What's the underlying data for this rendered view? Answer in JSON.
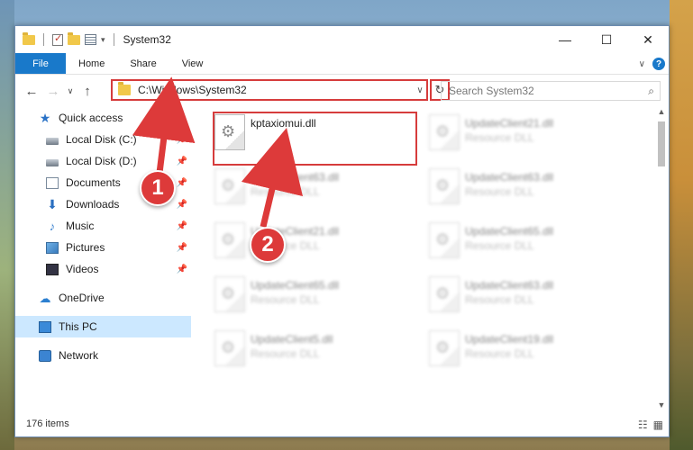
{
  "window": {
    "title": "System32",
    "minimize": "—",
    "maximize": "☐",
    "close": "✕"
  },
  "ribbon": {
    "file": "File",
    "tabs": [
      "Home",
      "Share",
      "View"
    ],
    "expand": "∨",
    "help": "?"
  },
  "nav": {
    "back": "←",
    "forward": "→",
    "recent": "∨",
    "up": "↑",
    "address": "C:\\Windows\\System32",
    "address_dropdown": "∨",
    "refresh": "↻",
    "search_placeholder": "Search System32",
    "search_icon": "⌕"
  },
  "sidebar": {
    "quick_access": "Quick access",
    "items": [
      {
        "label": "Local Disk (C:)",
        "icon": "disk-icon"
      },
      {
        "label": "Local Disk (D:)",
        "icon": "disk-icon"
      },
      {
        "label": "Documents",
        "icon": "documents-icon"
      },
      {
        "label": "Downloads",
        "icon": "download-icon"
      },
      {
        "label": "Music",
        "icon": "music-icon"
      },
      {
        "label": "Pictures",
        "icon": "pictures-icon"
      },
      {
        "label": "Videos",
        "icon": "videos-icon"
      }
    ],
    "onedrive": "OneDrive",
    "thispc": "This PC",
    "network": "Network"
  },
  "files": [
    {
      "name": "kptaxiomui.dll",
      "type": "",
      "focused": true
    },
    {
      "name": "UpdateClient21.dll",
      "type": "Resource DLL"
    },
    {
      "name": "UpdateClient63.dll",
      "type": "Resource DLL"
    },
    {
      "name": "UpdateClient63.dll",
      "type": "Resource DLL"
    },
    {
      "name": "UpdateClient21.dll",
      "type": "Resource DLL"
    },
    {
      "name": "UpdateClient65.dll",
      "type": "Resource DLL"
    },
    {
      "name": "UpdateClient65.dll",
      "type": "Resource DLL"
    },
    {
      "name": "UpdateClient63.dll",
      "type": "Resource DLL"
    },
    {
      "name": "UpdateClient5.dll",
      "type": "Resource DLL"
    },
    {
      "name": "UpdateClient19.dll",
      "type": "Resource DLL"
    }
  ],
  "status": {
    "count": "176 items"
  },
  "callouts": [
    "1",
    "2"
  ],
  "colors": {
    "accent": "#1979ca",
    "highlight": "#d63c3c",
    "selected": "#cce8ff"
  }
}
